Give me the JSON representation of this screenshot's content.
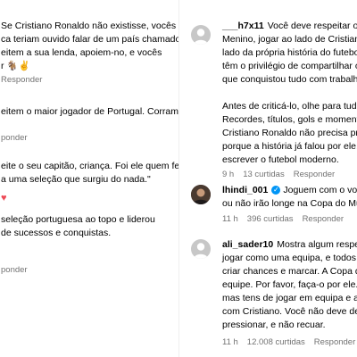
{
  "left": {
    "c1": {
      "lines": [
        "Se Cristiano Ronaldo não existisse, vocês",
        "ca teriam ouvido falar de um país chamado",
        "eitem a sua lenda, apoiem-no, e vocês",
        "r 🐐✌"
      ],
      "reply": "Responder"
    },
    "c2": {
      "lines": [
        "eitem o maior jogador de Portugal. Corram"
      ],
      "reply": "ponder"
    },
    "c3": {
      "lines": [
        "eite o seu capitão, criança. Foi ele quem fez",
        "a uma seleção que surgiu do nada.\""
      ],
      "reply": "ponder"
    },
    "c4": {
      "heart": "♥",
      "lines": [
        "seleção portuguesa ao topo e liderou",
        "de sucessos e conquistas."
      ],
      "reply": "ponder"
    }
  },
  "right": {
    "c1": {
      "username": "___h7x11",
      "lines": [
        "Você deve respeitar o m",
        "Menino, jogar ao lado de Cristiano",
        "lado da própria história do futebo",
        "têm o privilégio de compartilhar o",
        "que conquistou tudo com trabalh",
        "",
        "Antes de criticá-lo, olhe para tudo",
        "Recordes, títulos, gols e momento",
        "Cristiano Ronaldo não precisa pro",
        "porque a história já falou por ele.",
        "escrever o futebol moderno."
      ],
      "time": "9 h",
      "likes": "13 curtidas",
      "reply": "Responder"
    },
    "c2": {
      "username": "lhindi_001",
      "verified": "✓",
      "lines": [
        "Joguem com o vosso",
        "ou não irão longe na Copa do Mu"
      ],
      "time": "11 h",
      "likes": "396 curtidas",
      "reply": "Responder"
    },
    "c3": {
      "username": "ali_sader10",
      "lines": [
        "Mostra algum respeito",
        "jogar como uma equipa, e todos p",
        "criar chances e marcar. A Copa do",
        "equipe. Por favor, faça-o por ele. M",
        "mas tens de jogar em equipa e ava",
        "com Cristiano. Você não deve defe",
        "pressionar, e não recuar."
      ],
      "time": "11 h",
      "likes": "12.008 curtidas",
      "reply": "Responder"
    }
  }
}
